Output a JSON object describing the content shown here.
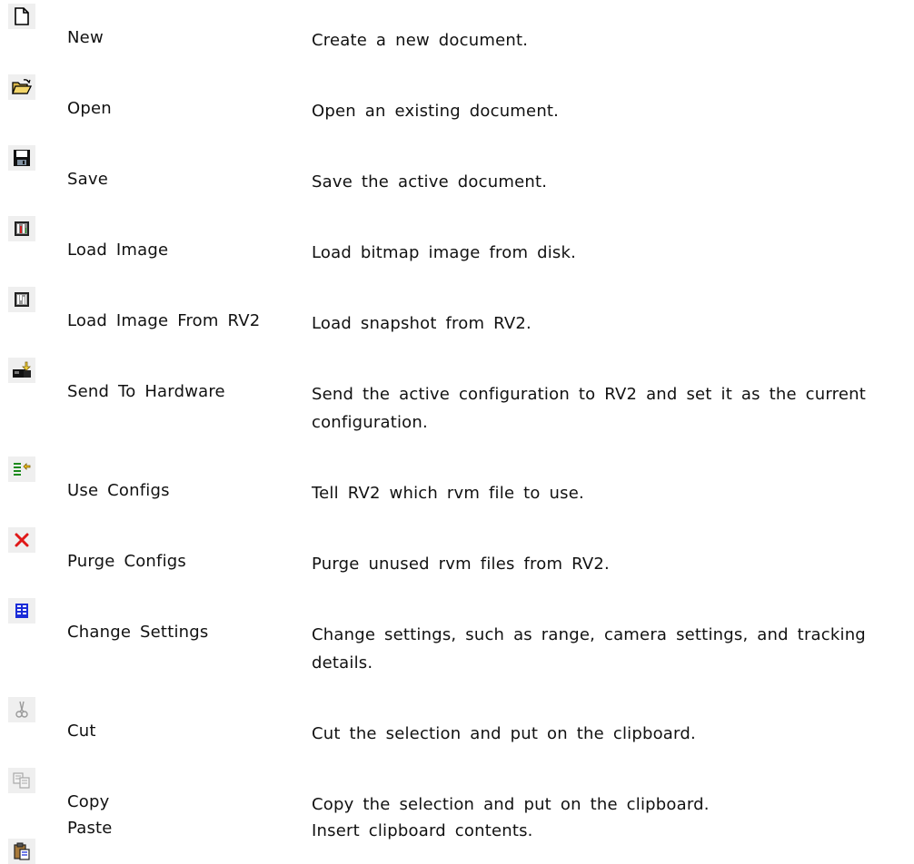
{
  "commands": [
    {
      "icon": "new-document-icon",
      "name": "New",
      "description": "Create a new document."
    },
    {
      "icon": "open-folder-icon",
      "name": "Open",
      "description": "Open an existing document."
    },
    {
      "icon": "save-disk-icon",
      "name": "Save",
      "description": "Save the active document."
    },
    {
      "icon": "load-image-icon",
      "name": "Load Image",
      "description": "Load bitmap image from disk."
    },
    {
      "icon": "load-image-rv2-icon",
      "name": "Load Image From RV2",
      "description": "Load snapshot from RV2."
    },
    {
      "icon": "send-to-hardware-icon",
      "name": "Send To Hardware",
      "description": "Send the active configuration to RV2 and set it as the current configuration."
    },
    {
      "icon": "use-configs-icon",
      "name": "Use Configs",
      "description": "Tell RV2 which rvm file to use."
    },
    {
      "icon": "purge-configs-icon",
      "name": "Purge Configs",
      "description": "Purge unused rvm files from RV2."
    },
    {
      "icon": "change-settings-icon",
      "name": "Change Settings",
      "description": "Change settings, such as range, camera settings, and tracking details."
    },
    {
      "icon": "cut-scissors-icon",
      "name": "Cut",
      "description": "Cut the selection and put on the clipboard."
    },
    {
      "icon": "copy-icon",
      "name": "Copy",
      "description": "Copy the selection and put on the clipboard."
    },
    {
      "icon": "paste-clipboard-icon",
      "name": "Paste",
      "description": "Insert clipboard contents."
    }
  ]
}
